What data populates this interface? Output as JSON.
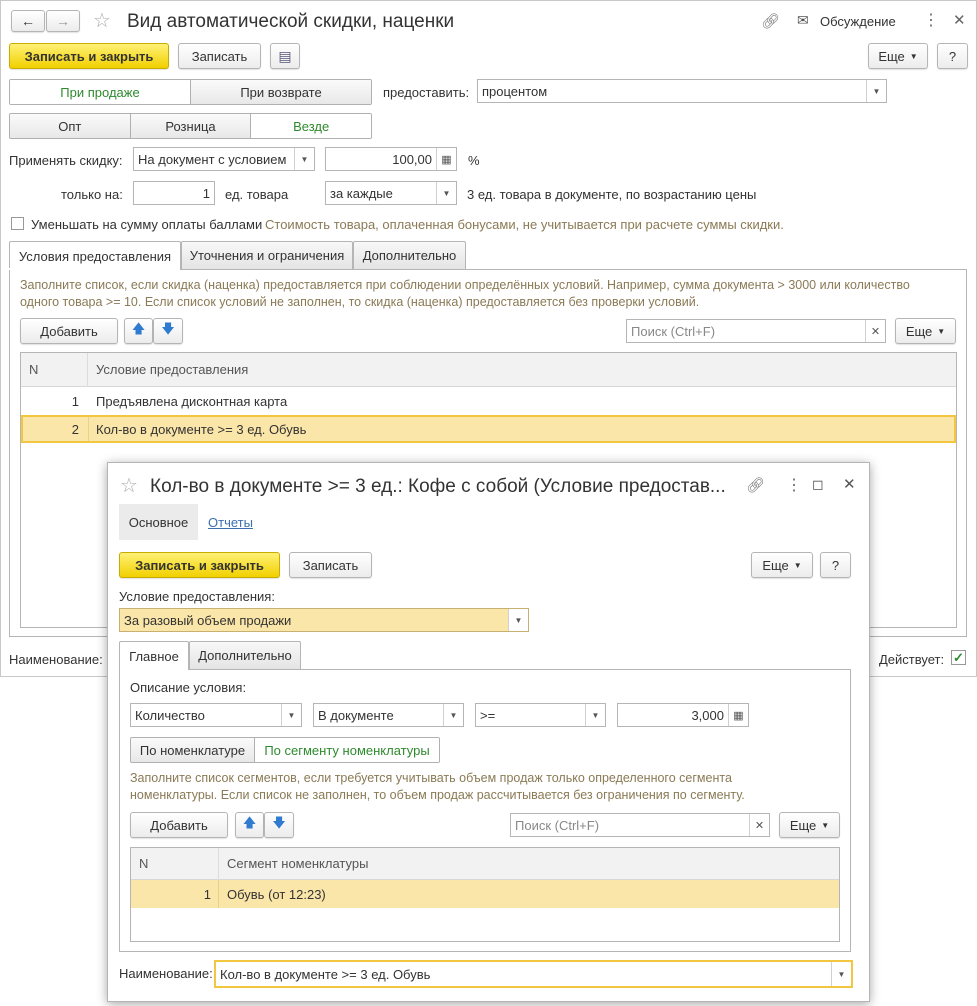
{
  "main": {
    "title": "Вид автоматической скидки, наценки",
    "discussion": "Обсуждение",
    "save_close": "Записать и закрыть",
    "save": "Записать",
    "more": "Еще",
    "help": "?",
    "sale_tabs": [
      "При продаже",
      "При возврате"
    ],
    "provide_label": "предоставить:",
    "provide_value": "процентом",
    "channel_tabs": [
      "Опт",
      "Розница",
      "Везде"
    ],
    "apply_label": "Применять скидку:",
    "apply_value": "На документ с условием",
    "percent_value": "100,00",
    "percent_sign": "%",
    "only_label": "только на:",
    "only_qty": "1",
    "unit_label": "ед. товара",
    "every_value": "за каждые",
    "every_suffix": "3 ед. товара в документе, по возрастанию цены",
    "bonus_checkbox": "Уменьшать на сумму оплаты баллами",
    "bonus_note": "Стоимость товара, оплаченная бонусами, не учитывается при расчете суммы скидки.",
    "tabs": [
      "Условия предоставления",
      "Уточнения и ограничения",
      "Дополнительно"
    ],
    "hint": "Заполните список, если скидка (наценка) предоставляется при соблюдении определённых условий. Например, сумма документа > 3000 или количество одного товара >= 10. Если список условий не заполнен, то скидка (наценка) предоставляется без проверки условий.",
    "add": "Добавить",
    "search_placeholder": "Поиск (Ctrl+F)",
    "col_n": "N",
    "col_condition": "Условие предоставления",
    "rows": [
      {
        "n": "1",
        "text": "Предъявлена дисконтная карта"
      },
      {
        "n": "2",
        "text": "Кол-во в документе >= 3 ед. Обувь"
      }
    ],
    "name_label": "Наименование:",
    "active_label": "Действует:"
  },
  "dialog": {
    "title": "Кол-во в документе >= 3 ед.: Кофе с собой (Условие предостав...",
    "nav": [
      "Основное",
      "Отчеты"
    ],
    "save_close": "Записать и закрыть",
    "save": "Записать",
    "more": "Еще",
    "help": "?",
    "condition_label": "Условие предоставления:",
    "condition_value": "За разовый объем продажи",
    "tabs": [
      "Главное",
      "Дополнительно"
    ],
    "desc_label": "Описание условия:",
    "f1": "Количество",
    "f2": "В документе",
    "f3": ">=",
    "f4": "3,000",
    "seg_tabs": [
      "По номенклатуре",
      "По сегменту номенклатуры"
    ],
    "hint": "Заполните список сегментов, если требуется учитывать объем продаж только определенного сегмента номенклатуры. Если список не заполнен, то объем продаж рассчитывается без ограничения по сегменту.",
    "add": "Добавить",
    "search_placeholder": "Поиск (Ctrl+F)",
    "col_n": "N",
    "col_segment": "Сегмент номенклатуры",
    "rows": [
      {
        "n": "1",
        "text": "Обувь (от 12:23)"
      }
    ],
    "name_label": "Наименование:",
    "name_value": "Кол-во в документе >= 3 ед. Обувь"
  },
  "colors": {
    "accent_yellow": "#f1d000",
    "selected_row": "#fbe6a9",
    "active_green": "#2e8a2e"
  }
}
